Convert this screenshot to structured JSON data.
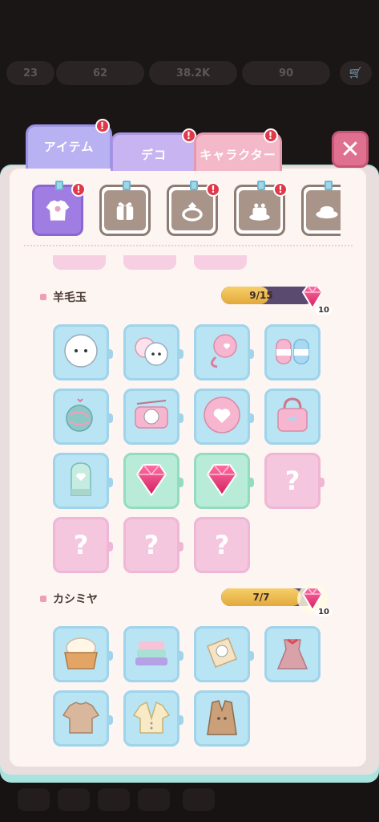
{
  "hud": {
    "level": "23",
    "hearts": "62",
    "coins": "38.2K",
    "gems": "90"
  },
  "tabs": [
    {
      "label": "アイテム",
      "badge": "!"
    },
    {
      "label": "デコ",
      "badge": "!"
    },
    {
      "label": "キャラクター",
      "badge": "!"
    }
  ],
  "close_label": "✕",
  "categories": [
    {
      "icon": "sweater-icon",
      "badge": "!",
      "active": true
    },
    {
      "icon": "gift-icon",
      "badge": "",
      "active": false
    },
    {
      "icon": "ring-icon",
      "badge": "!",
      "active": false
    },
    {
      "icon": "cake-icon",
      "badge": "!",
      "active": false
    },
    {
      "icon": "dish-icon",
      "badge": "",
      "active": false
    }
  ],
  "sections": [
    {
      "title": "羊毛玉",
      "progress_text": "9/15",
      "progress": 0.6,
      "reward": "10",
      "items": [
        {
          "name": "wool-puff-icon",
          "state": "owned"
        },
        {
          "name": "wool-pompoms-icon",
          "state": "owned"
        },
        {
          "name": "yarn-ball-icon",
          "state": "owned"
        },
        {
          "name": "yarn-skeins-icon",
          "state": "owned"
        },
        {
          "name": "yarn-ball-hearts-icon",
          "state": "owned"
        },
        {
          "name": "knitting-kitty-icon",
          "state": "owned"
        },
        {
          "name": "heart-cushion-icon",
          "state": "owned"
        },
        {
          "name": "knit-bag-icon",
          "state": "owned"
        },
        {
          "name": "mitten-icon",
          "state": "owned"
        },
        {
          "name": "gem-unlock-icon",
          "state": "gem"
        },
        {
          "name": "gem-unlock-icon",
          "state": "gem"
        },
        {
          "name": "unknown",
          "state": "locked",
          "label": "?"
        },
        {
          "name": "unknown",
          "state": "locked",
          "label": "?"
        },
        {
          "name": "unknown",
          "state": "locked",
          "label": "?"
        },
        {
          "name": "unknown",
          "state": "locked",
          "label": "?"
        }
      ]
    },
    {
      "title": "カシミヤ",
      "progress_text": "7/7",
      "progress": 1.0,
      "reward": "10",
      "items": [
        {
          "name": "wool-basket-icon",
          "state": "owned"
        },
        {
          "name": "folded-blankets-icon",
          "state": "owned"
        },
        {
          "name": "cinnamoroll-scarf-icon",
          "state": "owned"
        },
        {
          "name": "ribbon-dress-icon",
          "state": "owned"
        },
        {
          "name": "knit-sweater-icon",
          "state": "owned"
        },
        {
          "name": "cardigan-icon",
          "state": "owned"
        },
        {
          "name": "coat-icon",
          "state": "owned"
        }
      ]
    }
  ],
  "colors": {
    "accent": "#a07de2",
    "locked": "#f4c7df",
    "owned": "#b8e4f3",
    "gem": "#e83a77"
  }
}
